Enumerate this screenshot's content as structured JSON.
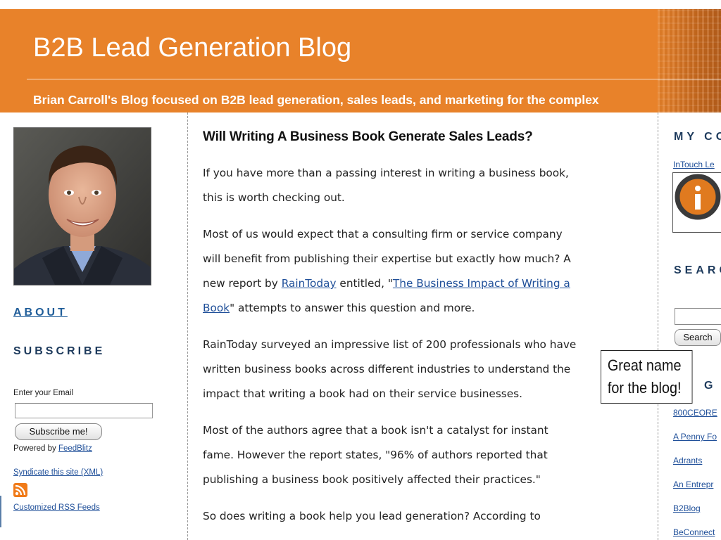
{
  "header": {
    "title": "B2B Lead Generation Blog",
    "subtitle": "Brian Carroll's Blog focused on B2B lead generation, sales leads, and marketing for the complex"
  },
  "sidebar": {
    "about_label": "ABOUT",
    "subscribe_label": "SUBSCRIBE",
    "email_label": "Enter your Email",
    "subscribe_button": "Subscribe me!",
    "powered_by_prefix": "Powered by ",
    "powered_by_link": "FeedBlitz",
    "syndicate_link": "Syndicate this site (XML)",
    "custom_rss_link": "Customized RSS Feeds"
  },
  "post": {
    "title": "Will Writing A Business Book Generate Sales Leads?",
    "p1": [
      "If you have more than a passing interest in writing a business book,",
      "this is worth checking out."
    ],
    "p2_l1": "Most of us would expect that a consulting firm or service company",
    "p2_l2": "will benefit from publishing their expertise but exactly how much? A",
    "p2_l3_pre": "new report by ",
    "p2_l3_link1": "RainToday",
    "p2_l3_mid": " entitled, \"",
    "p2_l3_link2": "The Business Impact of Writing a",
    "p2_l4_link2": "Book",
    "p2_l4_post": "\" attempts to answer this question and more.",
    "p3": [
      "RainToday surveyed an impressive list of 200 professionals who have",
      "written business books across different industries to understand the",
      "impact that writing a book had on their service businesses."
    ],
    "p4": [
      "Most of the authors agree that a book isn't a catalyst for instant",
      "fame.  However the report states, \"96% of authors reported that",
      "publishing a business book positively affected their practices.\""
    ],
    "p5": [
      "So does writing a book help you lead generation?  According to"
    ]
  },
  "right": {
    "my_heading": "MY CO",
    "intouch_link": "InTouch Le",
    "search_heading": "SEARC",
    "search_button": "Search",
    "blogs_heading": "G S",
    "blog_links": [
      "800CEORE",
      "A Penny Fo",
      "Adrants",
      "An Entrepr",
      "B2Blog",
      "BeConnect"
    ]
  },
  "callout": {
    "line1": "Great name",
    "line2": "for the blog!"
  },
  "colors": {
    "header_orange": "#e8822a",
    "link_blue": "#1f4f99",
    "heading_navy": "#1d3a5c",
    "rss_orange": "#f07a18"
  }
}
